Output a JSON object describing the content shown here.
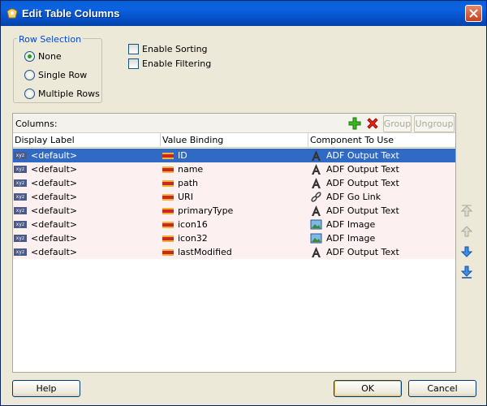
{
  "window": {
    "title": "Edit Table Columns"
  },
  "row_selection": {
    "legend": "Row Selection",
    "options": [
      {
        "label": "None",
        "selected": true
      },
      {
        "label": "Single Row",
        "selected": false
      },
      {
        "label": "Multiple Rows",
        "selected": false
      }
    ]
  },
  "options": {
    "enable_sorting": {
      "label": "Enable Sorting",
      "checked": false
    },
    "enable_filtering": {
      "label": "Enable Filtering",
      "checked": false
    }
  },
  "columns_panel": {
    "label": "Columns:",
    "group_label": "Group",
    "ungroup_label": "Ungroup",
    "headers": [
      "Display Label",
      "Value Binding",
      "Component To Use"
    ],
    "rows": [
      {
        "display_label": "<default>",
        "value_binding": "ID",
        "component": "ADF Output Text",
        "component_icon": "output-text-icon",
        "selected": true
      },
      {
        "display_label": "<default>",
        "value_binding": "name",
        "component": "ADF Output Text",
        "component_icon": "output-text-icon",
        "selected": false
      },
      {
        "display_label": "<default>",
        "value_binding": "path",
        "component": "ADF Output Text",
        "component_icon": "output-text-icon",
        "selected": false
      },
      {
        "display_label": "<default>",
        "value_binding": "URI",
        "component": "ADF Go Link",
        "component_icon": "go-link-icon",
        "selected": false
      },
      {
        "display_label": "<default>",
        "value_binding": "primaryType",
        "component": "ADF Output Text",
        "component_icon": "output-text-icon",
        "selected": false
      },
      {
        "display_label": "<default>",
        "value_binding": "icon16",
        "component": "ADF Image",
        "component_icon": "image-icon",
        "selected": false
      },
      {
        "display_label": "<default>",
        "value_binding": "icon32",
        "component": "ADF Image",
        "component_icon": "image-icon",
        "selected": false
      },
      {
        "display_label": "<default>",
        "value_binding": "lastModified",
        "component": "ADF Output Text",
        "component_icon": "output-text-icon",
        "selected": false
      }
    ]
  },
  "buttons": {
    "help": "Help",
    "ok": "OK",
    "cancel": "Cancel"
  },
  "colors": {
    "title_bar": "#0550c8",
    "selected_row": "#316ac5",
    "row_tint": "#fdf0f0",
    "legend_text": "#0046d5"
  }
}
